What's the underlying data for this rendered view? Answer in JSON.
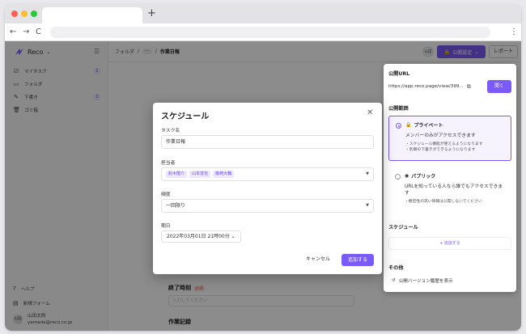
{
  "browser": {
    "new_tab": "+",
    "back": "←",
    "forward": "→",
    "reload": "C",
    "menu": "⋮"
  },
  "sidebar": {
    "workspace": "Reco",
    "items": [
      {
        "label": "マイタスク",
        "icon": "checkbox-icon",
        "badge": "1"
      },
      {
        "label": "フォルダ",
        "icon": "folder-icon"
      },
      {
        "label": "下書き",
        "icon": "pencil-icon",
        "badge": "1"
      },
      {
        "label": "ゴミ箱",
        "icon": "trash-icon"
      }
    ],
    "help": "ヘルプ",
    "feedback": "新規フォーム",
    "user": {
      "avatar": "山田",
      "name": "山田太郎",
      "email": "yamada@reco.co.jp"
    }
  },
  "topbar": {
    "crumb_folder": "フォルダ",
    "crumb_sep": "/",
    "crumb_ellipsis": "···",
    "crumb_current": "作業日報",
    "avatar": "山田",
    "publish_label": "公開設定",
    "report_label": "レポート"
  },
  "main": {
    "end_time_label": "終了時刻",
    "required_badge": "必須",
    "end_time_placeholder": "入力してください",
    "record_label": "作業記録"
  },
  "panel": {
    "url_section": "公開URL",
    "url": "https://app.reco.page/view/399...",
    "open_label": "開く",
    "scope_section": "公開範囲",
    "private_title": "プライベート",
    "private_desc": "メンバーのみがアクセスできます",
    "private_notes": [
      "・スケジュール機能が使えるようになります",
      "・別罪の下書きができるようになります"
    ],
    "public_title": "パブリック",
    "public_desc": "URLを知っている人なら誰でもアクセスできます",
    "public_notes": [
      "・機密性の高い情報は公開しないでください"
    ],
    "schedule_section": "スケジュール",
    "schedule_add": "+ 追加する",
    "other_section": "その他",
    "history_label": "公開バージョン履歴を表示"
  },
  "modal": {
    "title": "スケジュール",
    "task_label": "タスク名",
    "task_value": "作業日報",
    "assignee_label": "担当者",
    "assignees": [
      "鈴木隆介",
      "山本達也",
      "篠崎大輔"
    ],
    "frequency_label": "頻度",
    "frequency_value": "一回限り",
    "date_label": "期日",
    "date_value": "2022年03月01日 21時00分 ⌄",
    "cancel_label": "キャンセル",
    "add_label": "追加する"
  }
}
